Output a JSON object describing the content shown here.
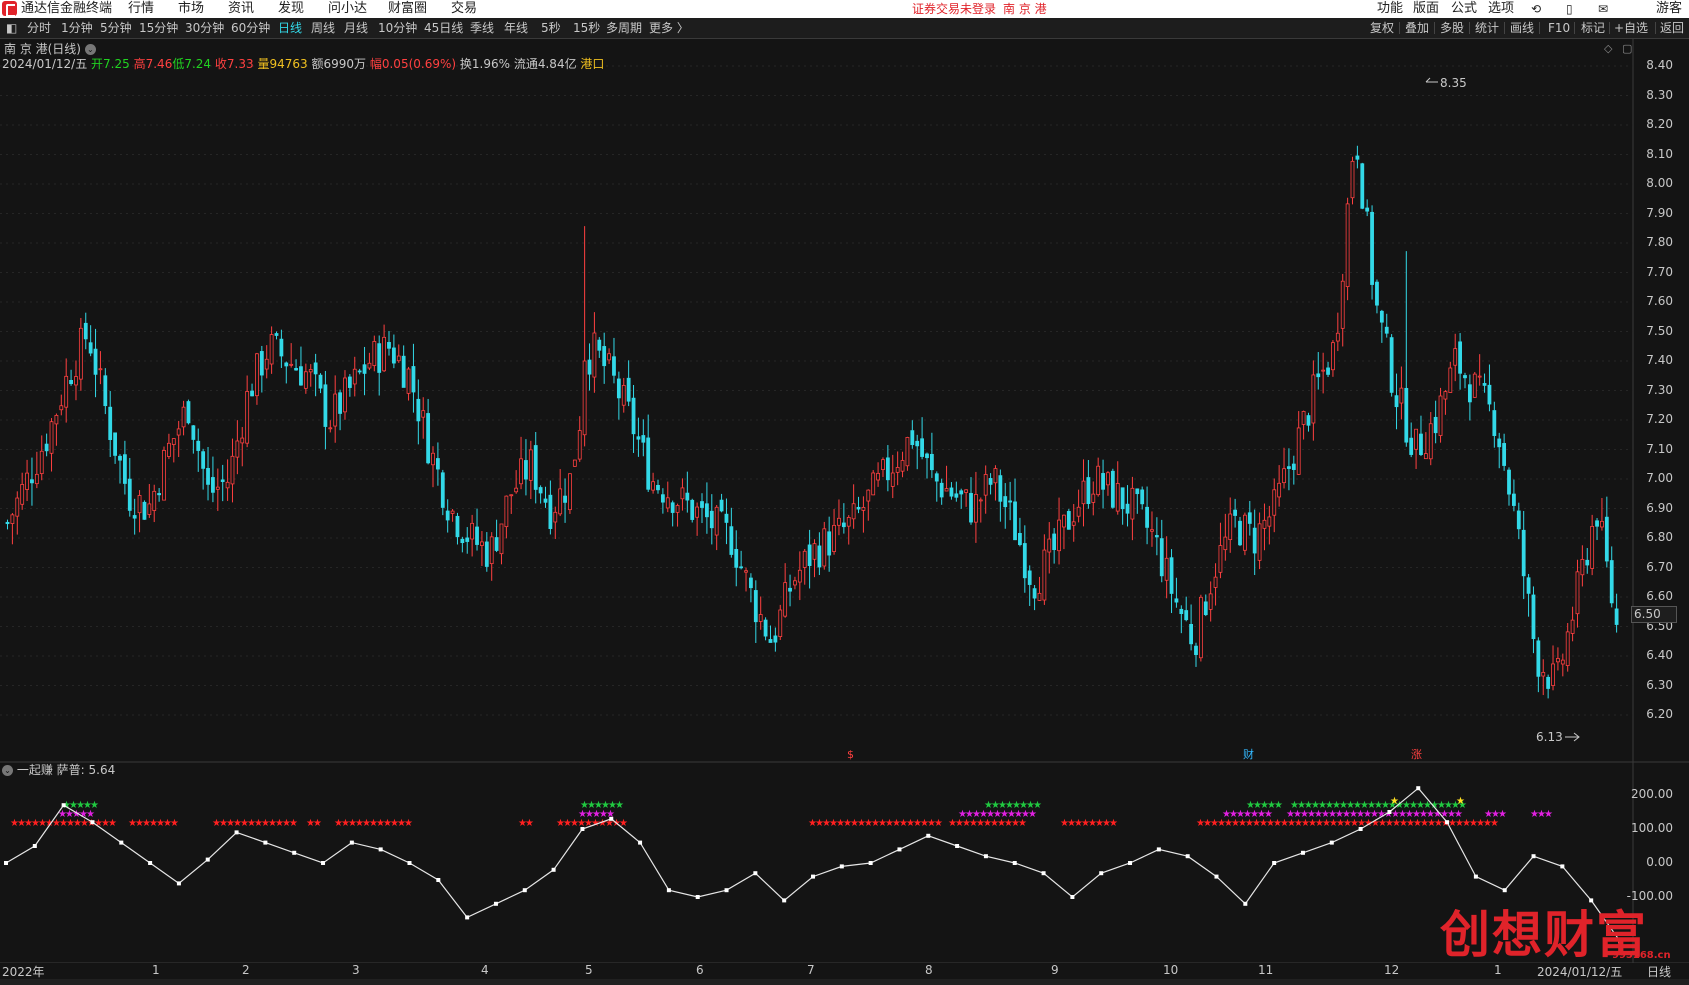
{
  "titlebar": {
    "app_name": "通达信金融终端",
    "menus": [
      "行情",
      "市场",
      "资讯",
      "发现",
      "问小达",
      "财富圈",
      "交易"
    ],
    "notice": "证券交易未登录",
    "notice_stock": "南 京 港",
    "right_menus": [
      "功能",
      "版面",
      "公式",
      "选项"
    ],
    "user": "游客"
  },
  "periods": [
    "分时",
    "1分钟",
    "5分钟",
    "15分钟",
    "30分钟",
    "60分钟",
    "日线",
    "周线",
    "月线",
    "10分钟",
    "45日线",
    "季线",
    "年线",
    "5秒",
    "15秒",
    "多周期",
    "更多 〉"
  ],
  "active_period": "日线",
  "tools": [
    "复权",
    "叠加",
    "多股",
    "统计",
    "画线",
    "F10",
    "标记",
    "+自选",
    "返回"
  ],
  "stock": {
    "name": "南 京 港(日线)",
    "date": "2024/01/12/五",
    "open_label": "开7.25",
    "high_label": "高7.46",
    "low_label": "低7.24",
    "close_label": "收7.33",
    "volume_label": "量94763",
    "amount_label": "额6990万",
    "change_label": "幅0.05(0.69%)",
    "turnover_label": "换1.96%",
    "float_label": "流通4.84亿",
    "sector_label": "港口"
  },
  "price_axis": [
    "8.40",
    "8.30",
    "8.20",
    "8.10",
    "8.00",
    "7.90",
    "7.80",
    "7.70",
    "7.60",
    "7.50",
    "7.40",
    "7.30",
    "7.20",
    "7.10",
    "7.00",
    "6.90",
    "6.80",
    "6.70",
    "6.60",
    "6.50",
    "6.40",
    "6.30",
    "6.20"
  ],
  "current_price": "6.50",
  "max_marker": "8.35",
  "min_marker": "6.13",
  "event_markers": [
    {
      "label": "$",
      "color": "#ff4040"
    },
    {
      "label": "财",
      "color": "#33b8ff"
    },
    {
      "label": "涨",
      "color": "#ff4040"
    }
  ],
  "indicator": {
    "title": "一起赚",
    "value_label": "萨普: 5.64",
    "axis": [
      "200.00",
      "100.00",
      "0.00",
      "-100.00"
    ]
  },
  "x_axis": [
    "2022年",
    "1",
    "2",
    "3",
    "4",
    "5",
    "6",
    "7",
    "8",
    "9",
    "10",
    "11",
    "12",
    "1",
    "2024/01/12/五",
    "日线"
  ],
  "watermark": "创想财富",
  "watermark_url": "995168.cn",
  "colors": {
    "up": "#ff4040",
    "down": "#33d9e8",
    "bg": "#141414",
    "grid": "#3a3a3a"
  },
  "chart_data": {
    "type": "candlestick",
    "date_range": [
      "2022年",
      "2024/01/12/五"
    ],
    "ylim": [
      6.13,
      8.35
    ],
    "close_path": [
      6.85,
      7.0,
      7.15,
      7.35,
      7.5,
      7.2,
      6.95,
      6.9,
      7.1,
      7.25,
      6.95,
      7.0,
      7.3,
      7.45,
      7.4,
      7.35,
      7.2,
      7.3,
      7.4,
      7.45,
      7.35,
      7.1,
      6.9,
      6.8,
      6.75,
      6.95,
      7.05,
      6.9,
      7.0,
      7.45,
      7.35,
      7.2,
      7.0,
      6.95,
      6.9,
      6.85,
      6.8,
      6.6,
      6.45,
      6.65,
      6.75,
      6.8,
      6.85,
      6.95,
      7.05,
      7.15,
      7.0,
      6.95,
      6.9,
      7.0,
      6.85,
      6.65,
      6.75,
      6.9,
      7.0,
      6.95,
      6.9,
      6.8,
      6.6,
      6.45,
      6.7,
      6.85,
      6.8,
      6.9,
      7.1,
      7.3,
      7.45,
      8.2,
      7.6,
      7.3,
      7.1,
      7.2,
      7.4,
      7.3,
      7.2,
      6.85,
      6.4,
      6.3,
      6.6,
      6.9,
      6.5
    ],
    "indicator_path": [
      0,
      50,
      170,
      120,
      60,
      0,
      -60,
      10,
      90,
      60,
      30,
      0,
      60,
      40,
      0,
      -50,
      -160,
      -120,
      -80,
      -20,
      100,
      130,
      60,
      -80,
      -100,
      -80,
      -30,
      -110,
      -40,
      -10,
      0,
      40,
      80,
      50,
      20,
      0,
      -30,
      -100,
      -30,
      0,
      40,
      20,
      -40,
      -120,
      0,
      30,
      60,
      100,
      150,
      220,
      120,
      -40,
      -80,
      20,
      -10,
      -110,
      -230
    ]
  }
}
